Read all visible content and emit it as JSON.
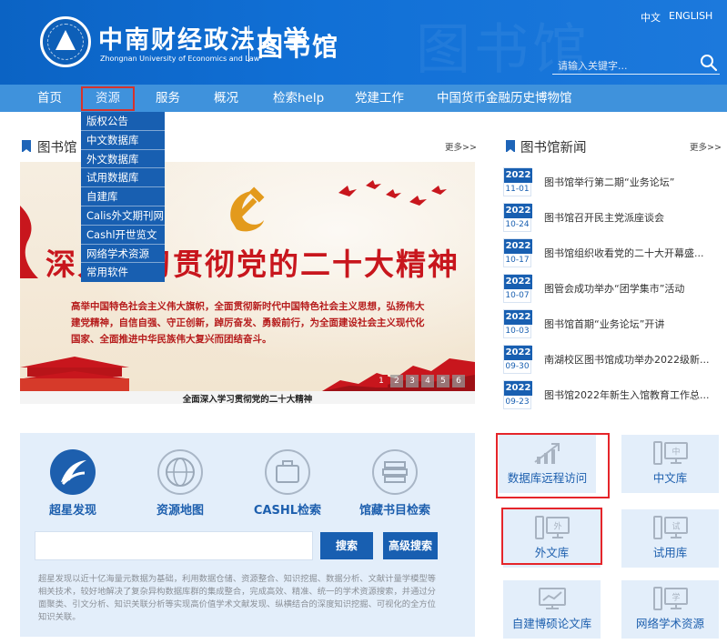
{
  "header": {
    "university_cn": "中南财经政法大学",
    "university_en": "Zhongnan University of Economics and Law",
    "library": "图书馆",
    "lang_cn": "中文",
    "lang_en": "ENGLISH",
    "search_placeholder": "请输入关键字..."
  },
  "nav": {
    "items": [
      "首页",
      "资源",
      "服务",
      "概况",
      "检索help",
      "党建工作",
      "中国货币金融历史博物馆"
    ],
    "active": "资源"
  },
  "dropdown": {
    "items": [
      "版权公告",
      "中文数据库",
      "外文数据库",
      "试用数据库",
      "自建库",
      "Calis外文期刊网",
      "Cashl开世览文",
      "网络学术资源",
      "常用软件"
    ]
  },
  "feature": {
    "title": "图书馆",
    "more": "更多>>",
    "slide_headline": "深入学习贯彻党的二十大精神",
    "slide_text": "高举中国特色社会主义伟大旗帜，全面贯彻新时代中国特色社会主义思想，弘扬伟大建党精神，自信自强、守正创新，踔厉奋发、勇毅前行，为全面建设社会主义现代化国家、全面推进中华民族伟大复兴而团结奋斗。",
    "caption": "全面深入学习贯彻党的二十大精神",
    "pages": [
      "1",
      "2",
      "3",
      "4",
      "5",
      "6"
    ],
    "active_page": "1"
  },
  "news": {
    "title": "图书馆新闻",
    "more": "更多>>",
    "items": [
      {
        "year": "2022",
        "md": "11-01",
        "title": "图书馆举行第二期“业务论坛”"
      },
      {
        "year": "2022",
        "md": "10-24",
        "title": "图书馆召开民主党派座谈会"
      },
      {
        "year": "2022",
        "md": "10-17",
        "title": "图书馆组织收看党的二十大开幕盛..."
      },
      {
        "year": "2022",
        "md": "10-07",
        "title": "图管会成功举办“团学集市”活动"
      },
      {
        "year": "2022",
        "md": "10-03",
        "title": "图书馆首期“业务论坛”开讲"
      },
      {
        "year": "2022",
        "md": "09-30",
        "title": "南湖校区图书馆成功举办2022级新..."
      },
      {
        "year": "2022",
        "md": "09-23",
        "title": "图书馆2022年新生入馆教育工作总..."
      }
    ]
  },
  "search_panel": {
    "tools": [
      "超星发现",
      "资源地图",
      "CASHL检索",
      "馆藏书目检索"
    ],
    "search_button": "搜索",
    "advanced_button": "高级搜索",
    "description": "超星发现以近十亿海量元数据为基础，利用数据仓储、资源整合、知识挖掘、数据分析、文献计量学模型等相关技术，较好地解决了复杂异构数据库群的集成整合，完成高效、精准、统一的学术资源搜索，并通过分面聚类、引文分析、知识关联分析等实现高价值学术文献发现、纵横结合的深度知识挖掘、可视化的全方位知识关联。"
  },
  "tiles": {
    "items": [
      {
        "label": "数据库远程访问",
        "badge": ""
      },
      {
        "label": "中文库",
        "badge": "中"
      },
      {
        "label": "外文库",
        "badge": "外"
      },
      {
        "label": "试用库",
        "badge": "试"
      },
      {
        "label": "自建博硕论文库",
        "badge": ""
      },
      {
        "label": "网络学术资源",
        "badge": "学"
      }
    ]
  },
  "colors": {
    "header_blue": "#0b63c4",
    "nav_blue": "#3f92dc",
    "dark_blue": "#185fb1",
    "highlight_red": "#e5252a",
    "panel_bg": "#e3eefa"
  }
}
